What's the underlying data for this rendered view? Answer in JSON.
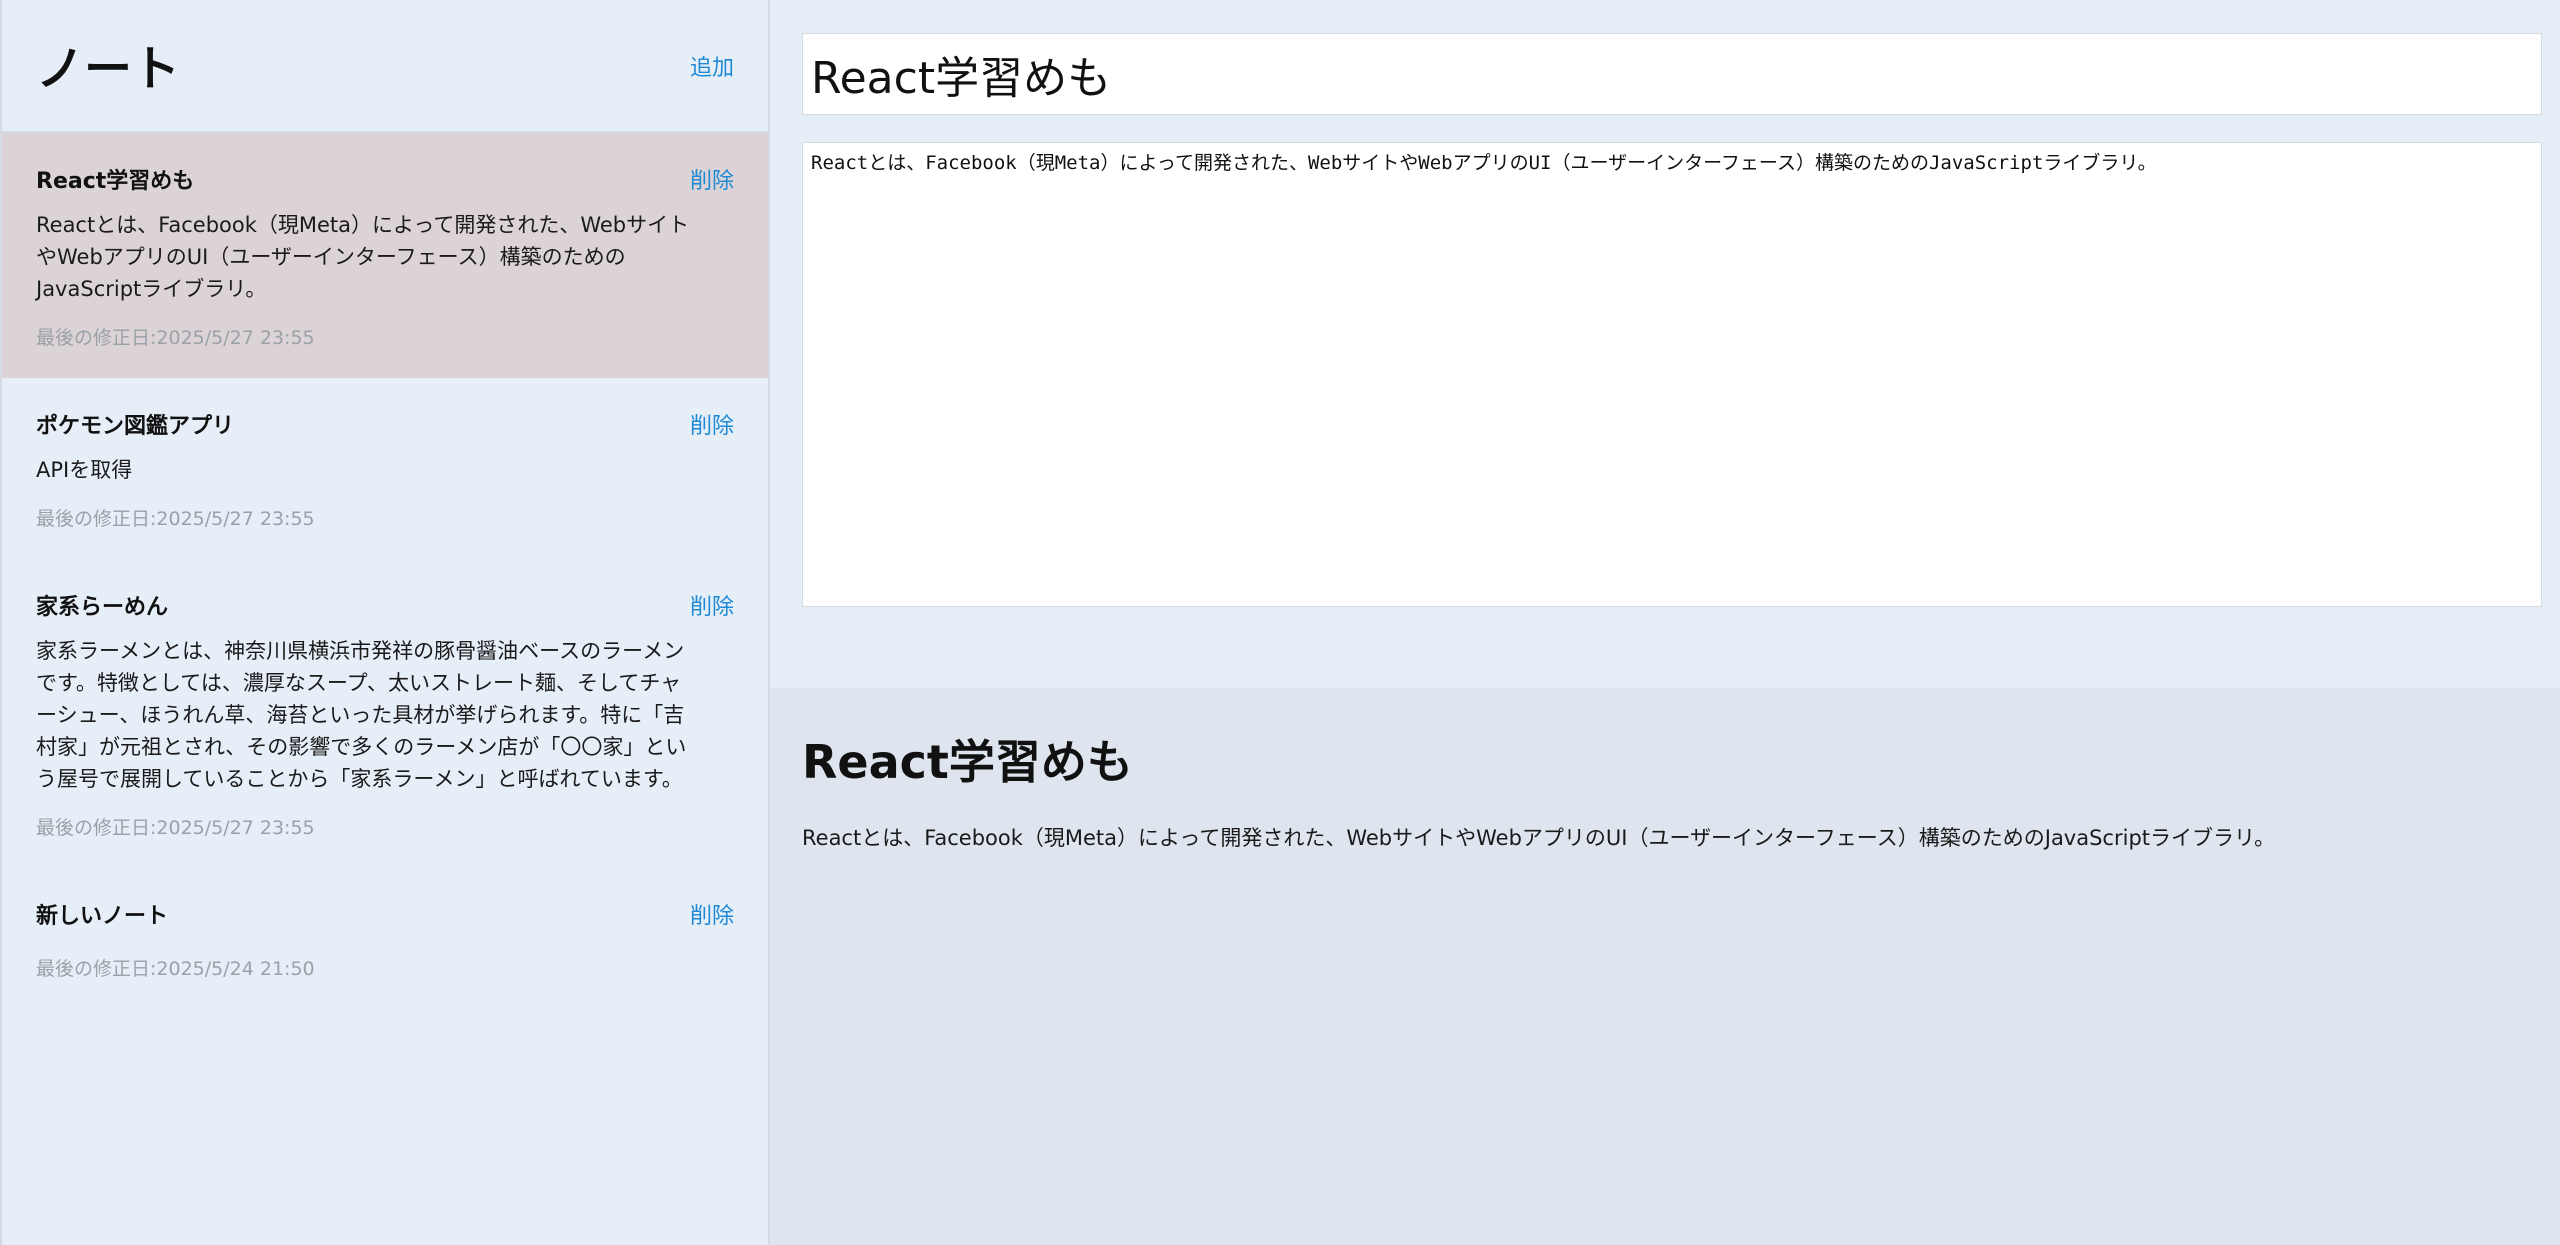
{
  "sidebar": {
    "title": "ノート",
    "add_label": "追加",
    "notes": [
      {
        "title": "React学習めも",
        "delete_label": "削除",
        "body": "Reactとは、Facebook（現Meta）によって開発された、WebサイトやWebアプリのUI（ユーザーインターフェース）構築のためのJavaScriptライブラリ。",
        "date": "最後の修正日:2025/5/27 23:55",
        "active": true
      },
      {
        "title": "ポケモン図鑑アプリ",
        "delete_label": "削除",
        "body": "APIを取得",
        "date": "最後の修正日:2025/5/27 23:55",
        "active": false
      },
      {
        "title": "家系らーめん",
        "delete_label": "削除",
        "body": "家系ラーメンとは、神奈川県横浜市発祥の豚骨醤油ベースのラーメンです。特徴としては、濃厚なスープ、太いストレート麺、そしてチャーシュー、ほうれん草、海苔といった具材が挙げられます。特に「吉村家」が元祖とされ、その影響で多くのラーメン店が「〇〇家」という屋号で展開していることから「家系ラーメン」と呼ばれています。",
        "date": "最後の修正日:2025/5/27 23:55",
        "active": false
      },
      {
        "title": "新しいノート",
        "delete_label": "削除",
        "body": "",
        "date": "最後の修正日:2025/5/24 21:50",
        "active": false
      }
    ]
  },
  "editor": {
    "title_value": "React学習めも",
    "body_value": "Reactとは、Facebook（現Meta）によって開発された、WebサイトやWebアプリのUI（ユーザーインターフェース）構築のためのJavaScriptライブラリ。"
  },
  "preview": {
    "title": "React学習めも",
    "body": "Reactとは、Facebook（現Meta）によって開発された、WebサイトやWebアプリのUI（ユーザーインターフェース）構築のためのJavaScriptライブラリ。"
  }
}
